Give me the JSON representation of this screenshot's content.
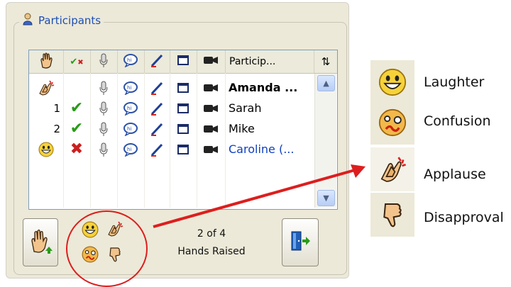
{
  "panel": {
    "title": "Participants",
    "title_icon": "participants-icon",
    "columns": [
      {
        "icon": "raise-hand-icon"
      },
      {
        "icon": "yes-no-icon"
      },
      {
        "icon": "microphone-icon"
      },
      {
        "icon": "chat-icon"
      },
      {
        "icon": "annotate-pen-icon"
      },
      {
        "icon": "screen-share-icon"
      },
      {
        "icon": "video-camera-icon"
      },
      {
        "label": "Particip...",
        "icon": "sort-icon"
      }
    ],
    "participants": [
      {
        "name": "Amanda ...",
        "order": "",
        "feedback": "applause",
        "response": "",
        "style": "bold"
      },
      {
        "name": "Sarah",
        "order": "1",
        "feedback": "",
        "response": "yes",
        "style": "normal"
      },
      {
        "name": "Mike",
        "order": "2",
        "feedback": "",
        "response": "yes",
        "style": "normal"
      },
      {
        "name": "Caroline (...",
        "order": "",
        "feedback": "laughter",
        "response": "no",
        "style": "blue"
      }
    ],
    "status_count": "2 of 4",
    "status_label": "Hands Raised"
  },
  "legend": [
    {
      "label": "Laughter",
      "icon": "laughter-icon"
    },
    {
      "label": "Confusion",
      "icon": "confusion-icon"
    },
    {
      "label": "Applause",
      "icon": "applause-icon"
    },
    {
      "label": "Disapproval",
      "icon": "disapproval-icon"
    }
  ],
  "colors": {
    "accent": "#1d4fb5",
    "highlight": "#dd1e1e",
    "check": "#2a9a1a"
  }
}
